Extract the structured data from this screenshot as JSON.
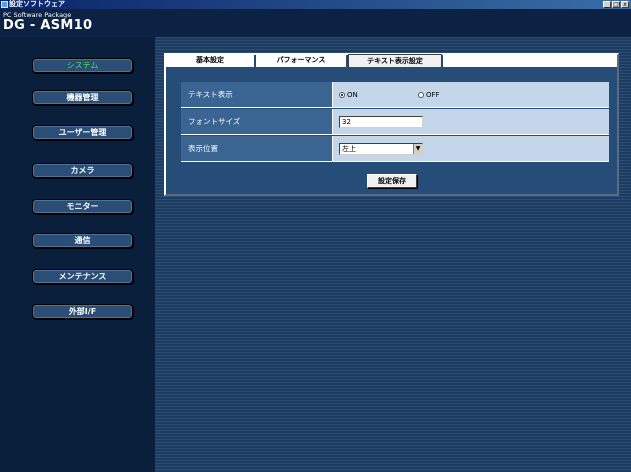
{
  "window": {
    "title": "設定ソフトウェア",
    "minimize_glyph": "_",
    "maximize_glyph": "□",
    "close_glyph": "x"
  },
  "header": {
    "package_label": "PC Software Package",
    "model": "DG - ASM10"
  },
  "sidebar": {
    "items": [
      {
        "label": "システム",
        "active": true
      },
      {
        "label": "機器管理",
        "active": false
      },
      {
        "label": "ユーザー管理",
        "active": false
      },
      {
        "label": "カメラ",
        "active": false
      },
      {
        "label": "モニター",
        "active": false
      },
      {
        "label": "通信",
        "active": false
      },
      {
        "label": "メンテナンス",
        "active": false
      },
      {
        "label": "外部I/F",
        "active": false
      }
    ]
  },
  "tabs": [
    {
      "label": "基本設定",
      "selected": false
    },
    {
      "label": "パフォーマンス",
      "selected": false
    },
    {
      "label": "テキスト表示設定",
      "selected": true
    }
  ],
  "form": {
    "text_display": {
      "label": "テキスト表示",
      "options": [
        "ON",
        "OFF"
      ],
      "selected": "ON"
    },
    "font_size": {
      "label": "フォントサイズ",
      "value": "32"
    },
    "position": {
      "label": "表示位置",
      "value": "左上"
    },
    "save_label": "設定保存"
  },
  "colors": {
    "active_nav_text": "#56e05a",
    "header_bg": "#0c2244",
    "panel_bg": "#254d78"
  }
}
